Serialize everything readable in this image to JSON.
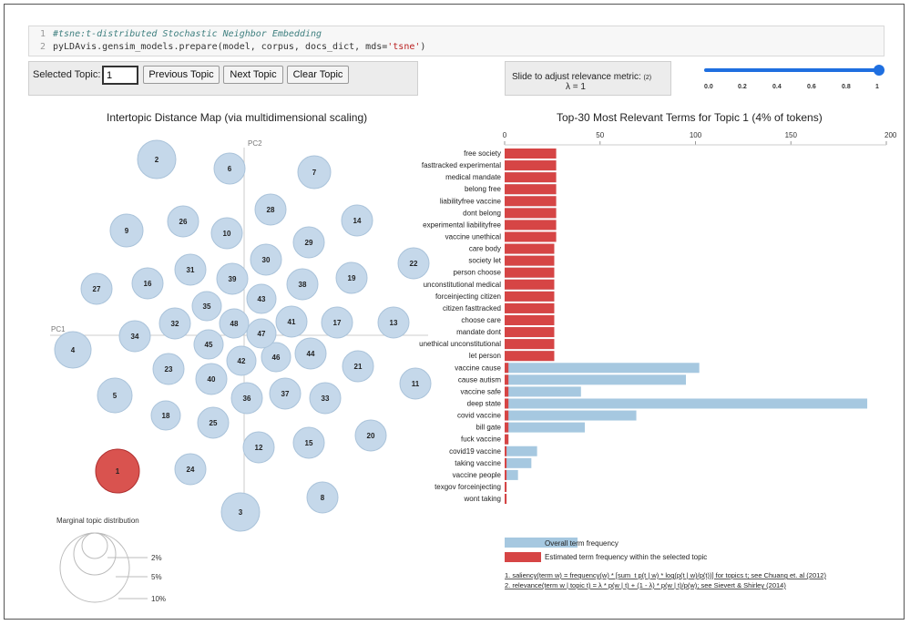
{
  "code": {
    "line1_num": "1",
    "line1": "#tsne:t-distributed Stochastic Neighbor Embedding",
    "line2_num": "2",
    "line2_a": "pyLDAvis.gensim_models.prepare(model, corpus, docs_dict, mds=",
    "line2_b": "'tsne'",
    "line2_c": ")"
  },
  "controls": {
    "selected_topic_label": "Selected Topic:",
    "selected_topic_value": "1",
    "prev_button": "Previous Topic",
    "next_button": "Next Topic",
    "clear_button": "Clear Topic",
    "slider_label": "Slide to adjust relevance metric:",
    "slider_footnote": "(2)",
    "lambda_text": "λ = 1",
    "slider_value": 1,
    "slider_ticks": [
      "0.0",
      "0.2",
      "0.4",
      "0.6",
      "0.8",
      "1"
    ]
  },
  "left": {
    "title": "Intertopic Distance Map (via multidimensional scaling)",
    "pc1": "PC1",
    "pc2": "PC2",
    "selected_topic": "1",
    "topics": [
      "1",
      "2",
      "3",
      "4",
      "5",
      "6",
      "7",
      "8",
      "9",
      "10",
      "11",
      "12",
      "13",
      "14",
      "15",
      "16",
      "17",
      "18",
      "19",
      "20",
      "21",
      "22",
      "23",
      "24",
      "25",
      "26",
      "27",
      "28",
      "29",
      "30",
      "31",
      "32",
      "33",
      "34",
      "35",
      "36",
      "37",
      "38",
      "39",
      "40",
      "41",
      "42",
      "43",
      "44",
      "45",
      "46",
      "47",
      "48"
    ],
    "marginal_title": "Marginal topic distribution",
    "marginal_labels": [
      "2%",
      "5%",
      "10%"
    ]
  },
  "right": {
    "title": "Top-30 Most Relevant Terms for Topic 1 (4% of tokens)",
    "legend_overall": "Overall term frequency",
    "legend_estimated": "Estimated term frequency within the selected topic",
    "footnote1": "1. saliency(term w) = frequency(w) * [sum_t p(t | w) * log(p(t | w)/p(t))] for topics t; see Chuang et. al (2012)",
    "footnote2": "2. relevance(term w | topic t) = λ * p(w | t) + (1 - λ) * p(w | t)/p(w); see Sievert & Shirley (2014)"
  },
  "colors": {
    "topic_bubble": "#c5d8ea",
    "selected_bubble": "#d9534f",
    "overall_bar": "#a6c8e0",
    "estimated_bar": "#d64545",
    "slider": "#1f6fe0"
  },
  "chart_data": {
    "type": "bar",
    "orientation": "horizontal",
    "title": "Top-30 Most Relevant Terms for Topic 1 (4% of tokens)",
    "xlim": [
      0,
      200
    ],
    "x_ticks": [
      "0",
      "50",
      "100",
      "150",
      "200"
    ],
    "categories": [
      "free society",
      "fasttracked experimental",
      "medical mandate",
      "belong free",
      "liabilityfree vaccine",
      "dont belong",
      "experimental liabilityfree",
      "vaccine unethical",
      "care body",
      "society let",
      "person choose",
      "unconstitutional medical",
      "forceinjecting citizen",
      "citizen fasttracked",
      "choose care",
      "mandate dont",
      "unethical unconstitutional",
      "let person",
      "vaccine cause",
      "cause autism",
      "vaccine safe",
      "deep state",
      "covid vaccine",
      "bill gate",
      "fuck vaccine",
      "covid19 vaccine",
      "taking vaccine",
      "vaccine people",
      "texgov forceinjecting",
      "wont taking"
    ],
    "series": [
      {
        "name": "Overall term frequency",
        "values": [
          27,
          27,
          27,
          27,
          27,
          27,
          27,
          27,
          26,
          26,
          26,
          26,
          26,
          26,
          26,
          26,
          26,
          26,
          102,
          95,
          40,
          190,
          69,
          42,
          2,
          17,
          14,
          7,
          1,
          1
        ]
      },
      {
        "name": "Estimated term frequency within the selected topic",
        "values": [
          27,
          27,
          27,
          27,
          27,
          27,
          27,
          27,
          26,
          26,
          26,
          26,
          26,
          26,
          26,
          26,
          26,
          26,
          2,
          2,
          2,
          2,
          2,
          2,
          2,
          1,
          1,
          1,
          1,
          1
        ]
      }
    ]
  }
}
